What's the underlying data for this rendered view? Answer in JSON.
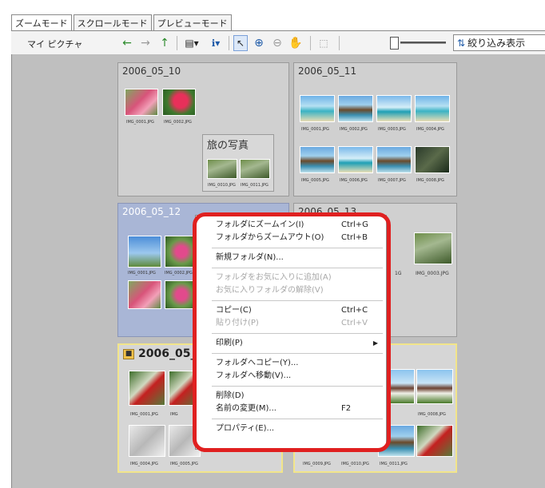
{
  "tabs": [
    "ズームモード",
    "スクロールモード",
    "プレビューモード"
  ],
  "breadcrumb": "マイ ピクチャ",
  "toolbar": {
    "icons": [
      "back-arrow-icon",
      "forward-arrow-icon",
      "up-arrow-icon",
      "view-icon",
      "info-icon",
      "select-icon",
      "zoom-in-icon",
      "zoom-out-icon",
      "hand-icon",
      "fit-icon"
    ],
    "filter_label": "絞り込み表示"
  },
  "folders": {
    "f1": {
      "title": "2006_05_10",
      "captions": [
        "IMG_0001.JPG",
        "IMG_0002.JPG"
      ],
      "subfolder": {
        "title": "旅の写真",
        "captions": [
          "IMG_0010.JPG",
          "IMG_0011.JPG"
        ]
      }
    },
    "f2": {
      "title": "2006_05_11",
      "captions": [
        "IMG_0001.JPG",
        "IMG_0002.JPG",
        "IMG_0003.JPG",
        "IMG_0004.JPG",
        "IMG_0005.JPG",
        "IMG_0006.JPG",
        "IMG_0007.JPG",
        "IMG_0008.JPG"
      ]
    },
    "f3": {
      "title": "2006_05_12",
      "captions": [
        "IMG_0001.JPG",
        "IMG_0002.JPG"
      ]
    },
    "f4": {
      "title": "2006_05_13",
      "captions": [
        "IMG_0003.JPG"
      ],
      "caption_partial": "1G"
    },
    "f5": {
      "title": "2006_05_14",
      "captions": [
        "IMG_0001.JPG",
        "IMG",
        "IMG_0004.JPG",
        "IMG_0005.JPG"
      ]
    },
    "f6": {
      "captions": [
        "IMG_0008.JPG",
        "IMG_0009.JPG",
        "IMG_0010.JPG",
        "IMG_0011.JPG"
      ]
    }
  },
  "context_menu": {
    "items": [
      {
        "label": "フォルダにズームイン(I)",
        "shortcut": "Ctrl+G",
        "disabled": false
      },
      {
        "label": "フォルダからズームアウト(O)",
        "shortcut": "Ctrl+B",
        "disabled": false
      },
      {
        "label": "新規フォルダ(N)...",
        "shortcut": "",
        "disabled": false
      },
      {
        "label": "フォルダをお気に入りに追加(A)",
        "shortcut": "",
        "disabled": true
      },
      {
        "label": "お気に入りフォルダの解除(V)",
        "shortcut": "",
        "disabled": true
      },
      {
        "label": "コピー(C)",
        "shortcut": "Ctrl+C",
        "disabled": false
      },
      {
        "label": "貼り付け(P)",
        "shortcut": "Ctrl+V",
        "disabled": true
      },
      {
        "label": "印刷(P)",
        "shortcut": "",
        "disabled": false
      },
      {
        "label": "フォルダへコピー(Y)...",
        "shortcut": "",
        "disabled": false
      },
      {
        "label": "フォルダへ移動(V)...",
        "shortcut": "",
        "disabled": false
      },
      {
        "label": "削除(D)",
        "shortcut": "",
        "disabled": false
      },
      {
        "label": "名前の変更(M)...",
        "shortcut": "F2",
        "disabled": false
      },
      {
        "label": "プロパティ(E)...",
        "shortcut": "",
        "disabled": false
      }
    ]
  },
  "colors": {
    "highlight_border": "#e02020",
    "selected_folder": "#a9b6d6",
    "folder_border_yellow": "#f2e58a"
  }
}
